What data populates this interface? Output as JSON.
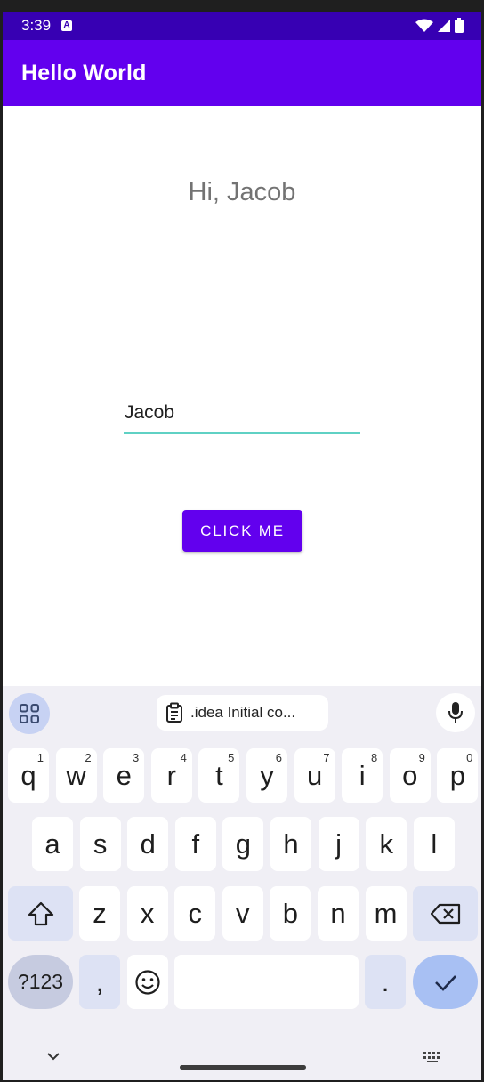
{
  "status_bar": {
    "time": "3:39",
    "notif_letter": "A"
  },
  "app_bar": {
    "title": "Hello World"
  },
  "content": {
    "greeting": "Hi, Jacob",
    "name_value": "Jacob",
    "button_label": "CLICK ME",
    "input_accent": "#5fd1c4",
    "primary": "#6200ee"
  },
  "keyboard": {
    "clipboard_text": ".idea Initial co...",
    "row1": [
      {
        "k": "q",
        "h": "1"
      },
      {
        "k": "w",
        "h": "2"
      },
      {
        "k": "e",
        "h": "3"
      },
      {
        "k": "r",
        "h": "4"
      },
      {
        "k": "t",
        "h": "5"
      },
      {
        "k": "y",
        "h": "6"
      },
      {
        "k": "u",
        "h": "7"
      },
      {
        "k": "i",
        "h": "8"
      },
      {
        "k": "o",
        "h": "9"
      },
      {
        "k": "p",
        "h": "0"
      }
    ],
    "row2": [
      "a",
      "s",
      "d",
      "f",
      "g",
      "h",
      "j",
      "k",
      "l"
    ],
    "row3": [
      "z",
      "x",
      "c",
      "v",
      "b",
      "n",
      "m"
    ],
    "sym_label": "?123",
    "comma": ",",
    "period": "."
  }
}
